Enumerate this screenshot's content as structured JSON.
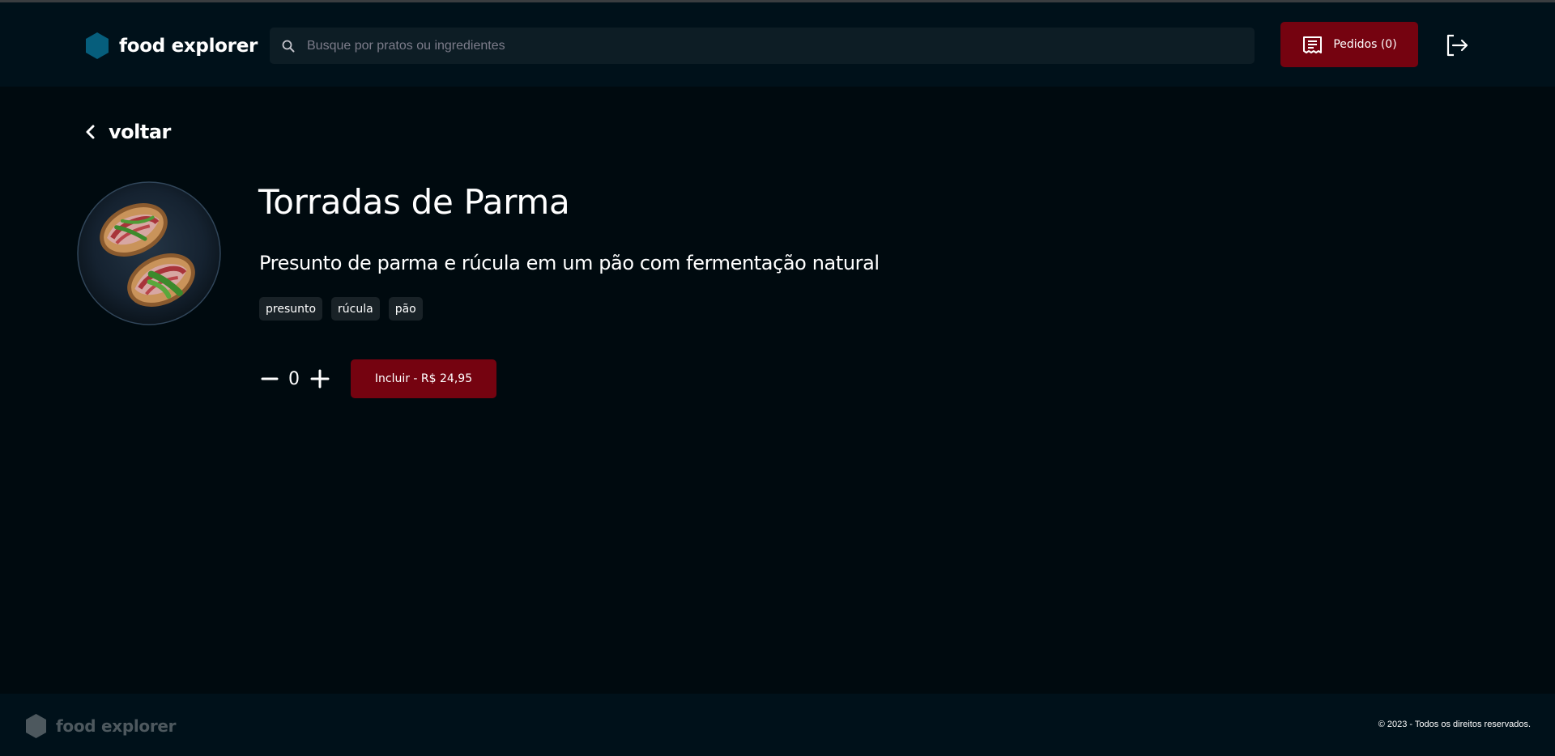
{
  "header": {
    "brand": "food explorer",
    "search": {
      "placeholder": "Busque por pratos ou ingredientes",
      "value": ""
    },
    "orders_label": "Pedidos (0)"
  },
  "main": {
    "back_label": "voltar",
    "dish": {
      "title": "Torradas de Parma",
      "description": "Presunto de parma e rúcula em um pão com fermentação natural",
      "tags": [
        "presunto",
        "rúcula",
        "pão"
      ],
      "quantity": "0",
      "include_label": "Incluir - R$ 24,95"
    }
  },
  "footer": {
    "brand": "food explorer",
    "copyright": "© 2023 - Todos os direitos reservados."
  },
  "colors": {
    "background": "#000a0f",
    "header_footer": "#00111a",
    "accent_red": "#750310",
    "brand_hex": "#065e7c",
    "tag_bg": "#192227",
    "search_bg": "#0d1d25"
  },
  "icons": [
    "hexagon-logo-icon",
    "search-icon",
    "receipt-icon",
    "sign-out-icon",
    "chevron-left-icon",
    "minus-icon",
    "plus-icon"
  ]
}
